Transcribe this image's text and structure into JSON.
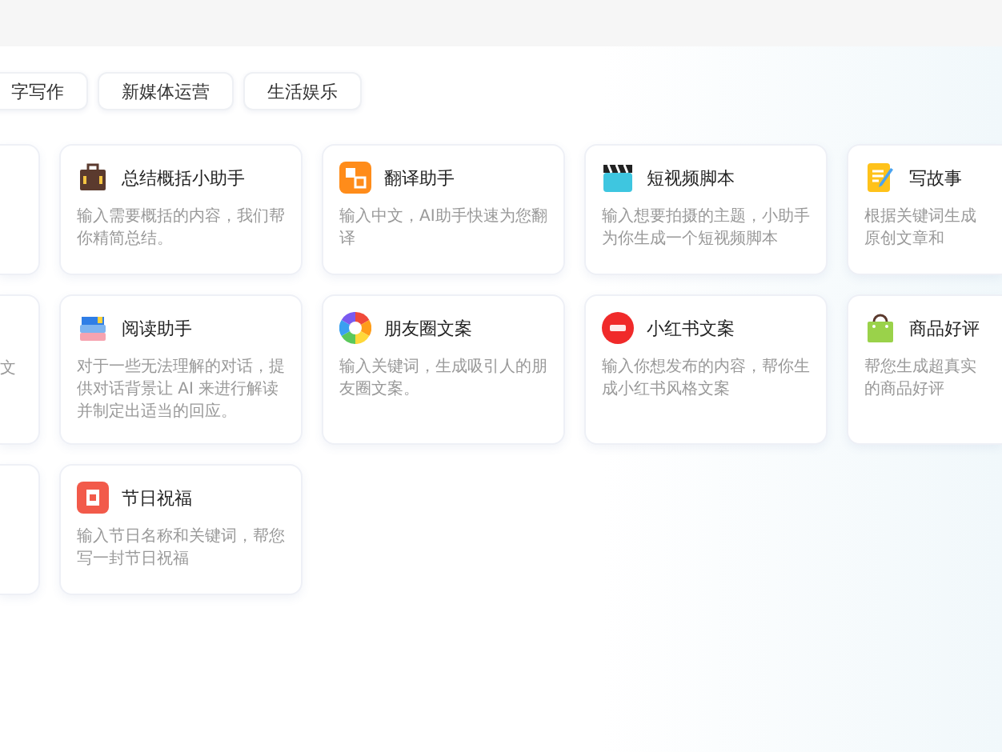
{
  "tabs": [
    {
      "label": "字写作"
    },
    {
      "label": "新媒体运营"
    },
    {
      "label": "生活娱乐"
    }
  ],
  "cards": [
    {
      "kind": "edge"
    },
    {
      "kind": "full",
      "title": "总结概括小助手",
      "description": "输入需要概括的内容，我们帮你精简总结。"
    },
    {
      "kind": "full",
      "title": "翻译助手",
      "description": "输入中文，AI助手快速为您翻译"
    },
    {
      "kind": "full",
      "title": "短视频脚本",
      "description": "输入想要拍摄的主题，小助手为你生成一个短视频脚本"
    },
    {
      "kind": "cut",
      "title": "写故事",
      "description": "根据关键词生成原创文章和"
    },
    {
      "kind": "edge",
      "description": "文"
    },
    {
      "kind": "full",
      "title": "阅读助手",
      "description": "对于一些无法理解的对话，提供对话背景让 AI 来进行解读并制定出适当的回应。"
    },
    {
      "kind": "full",
      "title": "朋友圈文案",
      "description": "输入关键词，生成吸引人的朋友圈文案。"
    },
    {
      "kind": "full",
      "title": "小红书文案",
      "description": "输入你想发布的内容，帮你生成小红书风格文案"
    },
    {
      "kind": "cut",
      "title": "商品好评",
      "description": "帮您生成超真实的商品好评"
    },
    {
      "kind": "edge"
    },
    {
      "kind": "full",
      "title": "节日祝福",
      "description": "输入节日名称和关键词，帮您写一封节日祝福"
    }
  ]
}
